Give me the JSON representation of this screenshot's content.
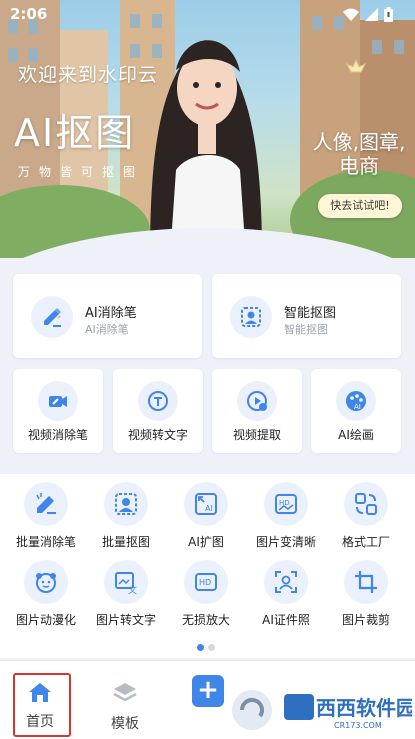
{
  "status_bar": {
    "time": "2:06"
  },
  "banner": {
    "welcome": "欢迎来到水印云",
    "title": "AI抠图",
    "subtitle": "万物皆可抠图",
    "tagline_line1": "人像,图章,",
    "tagline_line2": "电商",
    "cta": "快去试试吧!"
  },
  "feature_cards": [
    {
      "title": "AI消除笔",
      "subtitle": "AI消除笔",
      "icon": "pen-eraser-icon"
    },
    {
      "title": "智能抠图",
      "subtitle": "智能抠图",
      "icon": "image-cutout-icon"
    }
  ],
  "video_tools": [
    {
      "label": "视频消除笔",
      "icon": "video-eraser-icon"
    },
    {
      "label": "视频转文字",
      "icon": "video-to-text-icon"
    },
    {
      "label": "视频提取",
      "icon": "video-extract-icon"
    },
    {
      "label": "AI绘画",
      "icon": "palette-icon"
    }
  ],
  "tool_grid": [
    {
      "label": "批量消除笔",
      "icon": "batch-eraser-icon"
    },
    {
      "label": "批量抠图",
      "icon": "batch-cutout-icon"
    },
    {
      "label": "AI扩图",
      "icon": "ai-expand-icon"
    },
    {
      "label": "图片变清晰",
      "icon": "hd-image-icon"
    },
    {
      "label": "格式工厂",
      "icon": "format-factory-icon"
    },
    {
      "label": "图片动漫化",
      "icon": "anime-face-icon"
    },
    {
      "label": "图片转文字",
      "icon": "image-to-text-icon"
    },
    {
      "label": "无损放大",
      "icon": "hd-upscale-icon"
    },
    {
      "label": "AI证件照",
      "icon": "id-photo-icon"
    },
    {
      "label": "图片裁剪",
      "icon": "crop-icon"
    }
  ],
  "pagination": {
    "pages": 2,
    "active": 1
  },
  "bottom_nav": {
    "home": "首页",
    "templates": "模板"
  },
  "watermark": {
    "brand": "西西软件园",
    "domain": "CR173.COM"
  },
  "colors": {
    "accent": "#3f86e8",
    "highlight_frame": "#d9342b"
  }
}
